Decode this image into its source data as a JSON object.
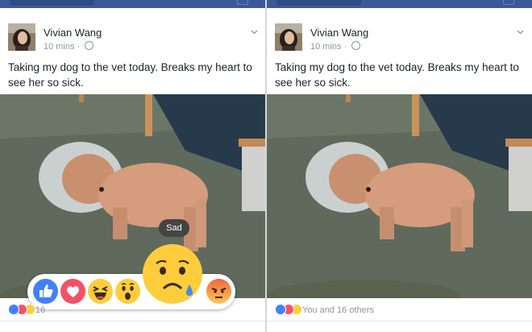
{
  "posts": [
    {
      "author": "Vivian Wang",
      "time": "10 mins",
      "separator": "·",
      "text": "Taking my dog to the vet today. Breaks my heart to see her so sick.",
      "reaction_count": "16"
    },
    {
      "author": "Vivian Wang",
      "time": "10 mins",
      "separator": "·",
      "text": "Taking my dog to the vet today. Breaks my heart to see her so sick.",
      "reaction_count": "You and 16 others"
    }
  ],
  "reaction_picker": {
    "tooltip": "Sad",
    "reactions": [
      "like-icon",
      "love-icon",
      "haha-icon",
      "wow-icon",
      "sad-icon",
      "angry-icon"
    ]
  },
  "colors": {
    "brand": "#3b5998",
    "like": "#4080ff",
    "love": "#f25268",
    "emoji_yellow": "#ffcd3c",
    "angry": "#f0663c"
  }
}
